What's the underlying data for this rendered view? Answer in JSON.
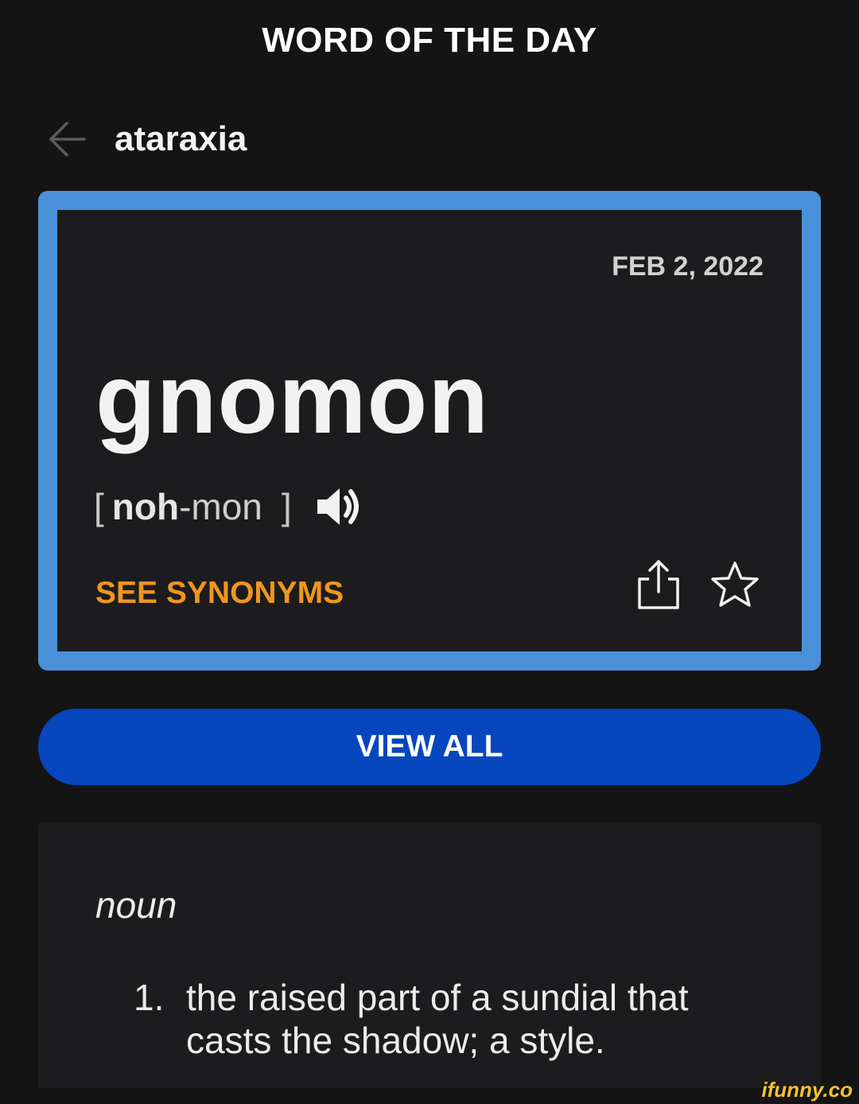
{
  "header": {
    "title": "WORD OF THE DAY"
  },
  "previous": {
    "back_icon": "arrow-left-icon",
    "word": "ataraxia"
  },
  "card": {
    "border_color": "#4a90d9",
    "date": "FEB 2, 2022",
    "word": "gnomon",
    "pronunciation": {
      "open_bracket": "[",
      "stressed": "noh",
      "unstressed": "-mon",
      "close_bracket": "]",
      "audio_icon": "speaker-icon"
    },
    "synonyms_label": "SEE SYNONYMS",
    "synonyms_color": "#f0961e",
    "share_icon": "share-icon",
    "favorite_icon": "star-icon"
  },
  "view_all": {
    "label": "VIEW ALL",
    "color": "#0646be"
  },
  "definition": {
    "part_of_speech": "noun",
    "items": [
      {
        "number": "1.",
        "text": "the raised part of a sundial that casts the shadow; a style."
      }
    ]
  },
  "watermark": "ifunny.co"
}
